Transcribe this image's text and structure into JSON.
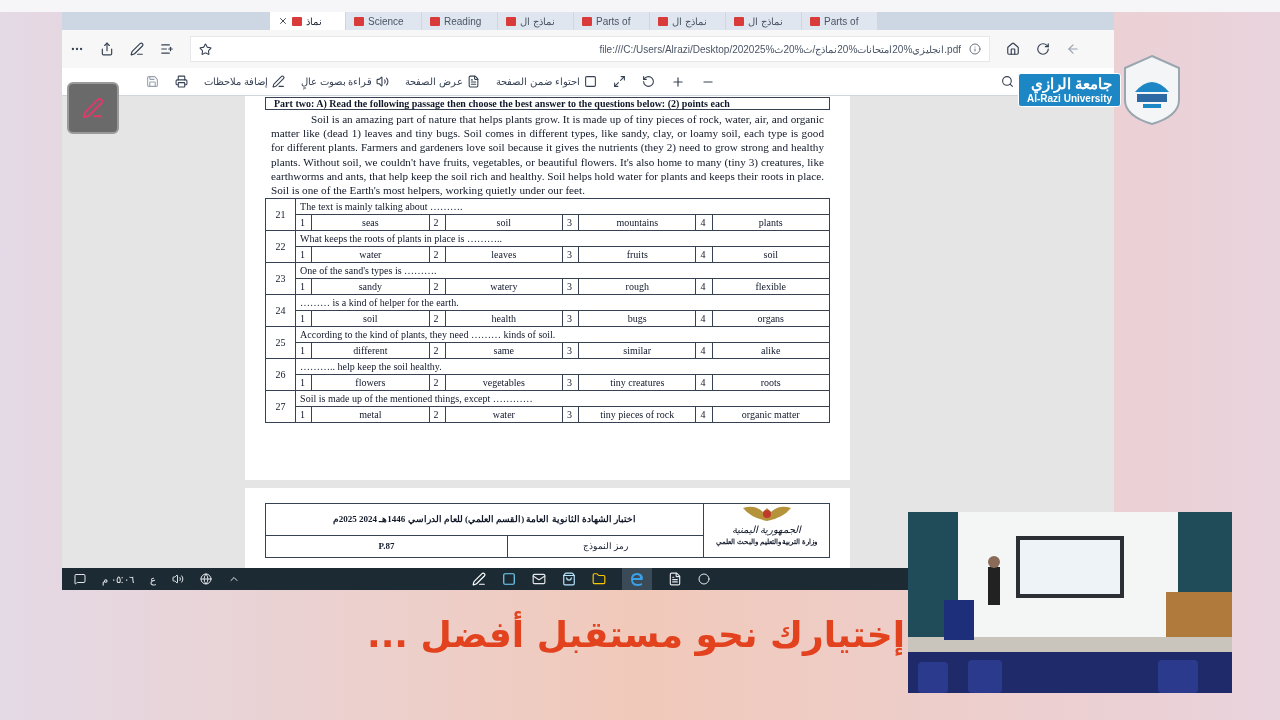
{
  "browser": {
    "tabs": [
      {
        "label": "نماذ",
        "selected": true
      },
      {
        "label": "Science",
        "selected": false
      },
      {
        "label": "Reading",
        "selected": false
      },
      {
        "label": "نماذج ال",
        "selected": false
      },
      {
        "label": "Parts of",
        "selected": false
      },
      {
        "label": "نماذج ال",
        "selected": false
      },
      {
        "label": "نماذج ال",
        "selected": false
      },
      {
        "label": "Parts of",
        "selected": false
      }
    ],
    "url": "file:///C:/Users/Alrazi/Desktop/202025%انجليزي%20امتحانات%20نماذج/ث%20ث.pdf"
  },
  "pdf_toolbar": {
    "items": [
      {
        "kind": "fit_page",
        "label": "احتواء ضمن الصفحة"
      },
      {
        "kind": "page_view",
        "label": "عرض الصفحة"
      },
      {
        "kind": "read_aloud",
        "label": "قراءة بصوت عالٍ"
      },
      {
        "kind": "add_notes",
        "label": "إضافة ملاحظات"
      }
    ]
  },
  "document": {
    "part_heading": "Part two: A) Read the following passage then choose the best answer to the questions below:    (2) points each",
    "passage": "Soil is an amazing part of nature that helps plants grow. It is made up of tiny pieces of rock, water, air, and organic matter like (dead 1) leaves and tiny bugs. Soil comes in different types, like sandy, clay, or loamy soil, each type is good for different plants. Farmers and gardeners love soil because it gives the nutrients (they 2) need to grow strong and healthy plants. Without soil, we couldn't have fruits, vegetables, or beautiful flowers. It's also home to many (tiny 3) creatures, like earthworms and ants, that help keep the soil rich and healthy. Soil helps hold water for plants and keeps their roots in place. Soil is one of the Earth's most helpers, working quietly under our feet.",
    "questions": [
      {
        "number": "21",
        "prompt": "The text is mainly talking about ……….",
        "options": [
          {
            "number": "1",
            "text": "seas"
          },
          {
            "number": "2",
            "text": "soil"
          },
          {
            "number": "3",
            "text": "mountains"
          },
          {
            "number": "4",
            "text": "plants"
          }
        ]
      },
      {
        "number": "22",
        "prompt": "What  keeps the roots of plants in place is ………..",
        "options": [
          {
            "number": "1",
            "text": "water"
          },
          {
            "number": "2",
            "text": "leaves"
          },
          {
            "number": "3",
            "text": "fruits"
          },
          {
            "number": "4",
            "text": "soil"
          }
        ]
      },
      {
        "number": "23",
        "prompt": "One of the sand's types is ……….",
        "options": [
          {
            "number": "1",
            "text": "sandy"
          },
          {
            "number": "2",
            "text": "watery"
          },
          {
            "number": "3",
            "text": "rough"
          },
          {
            "number": "4",
            "text": "flexible"
          }
        ]
      },
      {
        "number": "24",
        "prompt": "……… is a kind of helper for the earth.",
        "options": [
          {
            "number": "1",
            "text": "soil"
          },
          {
            "number": "2",
            "text": "health"
          },
          {
            "number": "3",
            "text": "bugs"
          },
          {
            "number": "4",
            "text": "organs"
          }
        ]
      },
      {
        "number": "25",
        "prompt": "According to the kind of plants, they need ……… kinds of soil.",
        "options": [
          {
            "number": "1",
            "text": "different"
          },
          {
            "number": "2",
            "text": "same"
          },
          {
            "number": "3",
            "text": "similar"
          },
          {
            "number": "4",
            "text": "alike"
          }
        ]
      },
      {
        "number": "26",
        "prompt": "……….. help keep the soil healthy.",
        "options": [
          {
            "number": "1",
            "text": "flowers"
          },
          {
            "number": "2",
            "text": "vegetables"
          },
          {
            "number": "3",
            "text": "tiny creatures"
          },
          {
            "number": "4",
            "text": "roots"
          }
        ]
      },
      {
        "number": "27",
        "prompt": "Soil is made up of the mentioned things, except …………",
        "options": [
          {
            "number": "1",
            "text": "metal"
          },
          {
            "number": "2",
            "text": "water"
          },
          {
            "number": "3",
            "text": "tiny pieces of rock"
          },
          {
            "number": "4",
            "text": "organic matter"
          }
        ]
      }
    ]
  },
  "second_page": {
    "exam_title": "اختبار الشهادة الثانوية العامة (القسم العلمي) للعام الدراسي 1446هـ  2024  2025م",
    "model_code_label": "رمز النموذج",
    "model_code": "P.87",
    "country": "الجمهورية اليمنية",
    "ministry": "وزارة التربية والتعليم والبحث العلمي"
  },
  "taskbar": {
    "time": "٠٥:٠٦ م",
    "language": "ع"
  },
  "logo": {
    "arabic_name": "جامعة الرازي",
    "english_name": "Al-Razi University"
  },
  "banner": {
    "slogan": "إختيارك نحو مستقبل أفضل ..."
  }
}
